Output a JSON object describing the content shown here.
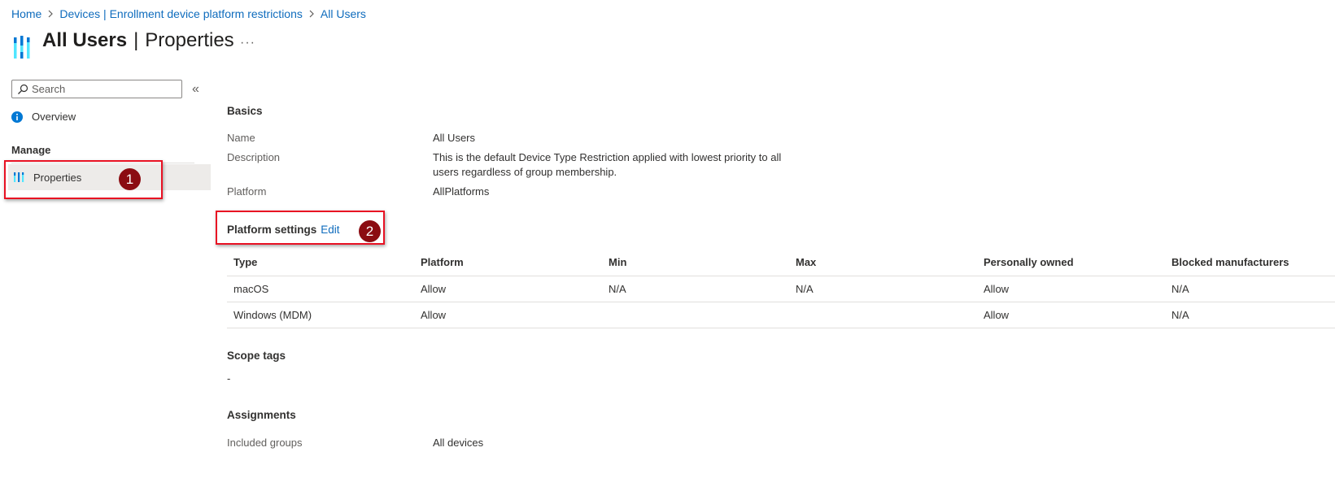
{
  "breadcrumb": [
    {
      "label": "Home"
    },
    {
      "label": "Devices | Enrollment device platform restrictions"
    },
    {
      "label": "All Users"
    }
  ],
  "title": {
    "bold": "All Users",
    "separator": "|",
    "rest": "Properties",
    "more": "···"
  },
  "sidebar": {
    "search_placeholder": "Search",
    "collapse": "«",
    "overview": "Overview",
    "manage": "Manage",
    "properties": "Properties"
  },
  "callouts": [
    "1",
    "2"
  ],
  "basics": {
    "heading": "Basics",
    "name_label": "Name",
    "name_value": "All Users",
    "description_label": "Description",
    "description_line1": "This is the default Device Type Restriction applied with lowest priority to all",
    "description_line2": "users regardless of group membership.",
    "platform_label": "Platform",
    "platform_value": "AllPlatforms"
  },
  "platform_settings": {
    "heading": "Platform settings",
    "edit": "Edit",
    "columns": [
      "Type",
      "Platform",
      "Min",
      "Max",
      "Personally owned",
      "Blocked manufacturers"
    ],
    "rows": [
      [
        "macOS",
        "Allow",
        "N/A",
        "N/A",
        "Allow",
        "N/A"
      ],
      [
        "Windows (MDM)",
        "Allow",
        "",
        "",
        "Allow",
        "N/A"
      ]
    ]
  },
  "scope_tags": {
    "heading": "Scope tags",
    "value": "-"
  },
  "assignments": {
    "heading": "Assignments",
    "included_label": "Included groups",
    "included_value": "All devices"
  },
  "colors": {
    "link": "#0f6cbd",
    "callout_border": "#e81123",
    "callout_badge": "#8b0c12",
    "selected_bg": "#edebe9"
  }
}
